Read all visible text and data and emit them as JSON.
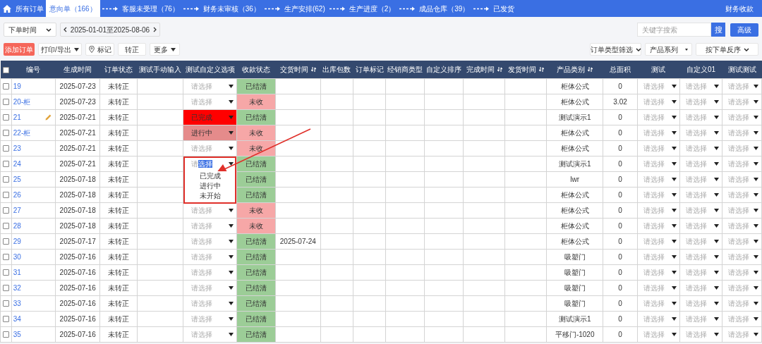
{
  "nav": {
    "tabs": [
      {
        "label": "所有订单",
        "selected": false,
        "kind": "home"
      },
      {
        "label": "意向单（166）",
        "selected": true,
        "kind": "plain"
      },
      {
        "label": "客服未受理（76）",
        "selected": false,
        "kind": "step"
      },
      {
        "label": "财务未审核（36）",
        "selected": false,
        "kind": "step"
      },
      {
        "label": "生产安排(62)",
        "selected": false,
        "kind": "step"
      },
      {
        "label": "生产进度（2）",
        "selected": false,
        "kind": "step"
      },
      {
        "label": "成品仓库（39）",
        "selected": false,
        "kind": "step"
      },
      {
        "label": "已发货",
        "selected": false,
        "kind": "step"
      }
    ],
    "right_link": "财务收款"
  },
  "filters": {
    "time_field": "下单时间",
    "date_range": "2025-01-01至2025-08-06",
    "search": {
      "placeholder": "关键字搜索"
    },
    "search_button": "搜",
    "advanced_button": "高级"
  },
  "actions": {
    "add": "添加订单",
    "print": "打印/导出",
    "mark": "标记",
    "convert": "转正",
    "more": "更多"
  },
  "sorters": {
    "order_type": "订单类型筛选",
    "series": "产品系列",
    "sort": "按下单反序"
  },
  "table": {
    "select_all": {
      "checked": false
    },
    "columns": [
      {
        "label": "编号",
        "sortable": false
      },
      {
        "label": "生成时间",
        "sortable": false
      },
      {
        "label": "订单状态",
        "sortable": false
      },
      {
        "label": "测试手动输入",
        "sortable": false
      },
      {
        "label": "测试自定义选项",
        "sortable": false
      },
      {
        "label": "收款状态",
        "sortable": false
      },
      {
        "label": "交货时间",
        "sortable": true
      },
      {
        "label": "出库包数",
        "sortable": false
      },
      {
        "label": "订单标记",
        "sortable": false
      },
      {
        "label": "经销商类型",
        "sortable": false
      },
      {
        "label": "自定义排序",
        "sortable": false
      },
      {
        "label": "完成时间",
        "sortable": true
      },
      {
        "label": "发货时间",
        "sortable": true
      },
      {
        "label": "产品类别",
        "sortable": true
      },
      {
        "label": "总面积",
        "sortable": false
      },
      {
        "label": "测试",
        "sortable": false
      },
      {
        "label": "自定义01",
        "sortable": false
      },
      {
        "label": "测试测试",
        "sortable": false
      }
    ],
    "rows": [
      {
        "checked": false,
        "id": "19",
        "pencil": false,
        "date": "2025-07-23",
        "status": "未转正",
        "option": {
          "text": "请选择",
          "kind": "empty"
        },
        "payment": {
          "text": "已结清",
          "kind": "paid"
        },
        "product": "柜体公式",
        "area": "0",
        "selects": [
          "请选择",
          "请选择",
          "请选择"
        ]
      },
      {
        "checked": false,
        "id": "20-柜",
        "pencil": false,
        "date": "2025-07-23",
        "status": "未转正",
        "option": {
          "text": "请选择",
          "kind": "empty"
        },
        "payment": {
          "text": "未收",
          "kind": "unpaid"
        },
        "product": "柜体公式",
        "area": "3.02",
        "selects": [
          "请选择",
          "请选择",
          "请选择"
        ]
      },
      {
        "checked": false,
        "id": "21",
        "pencil": true,
        "date": "2025-07-21",
        "status": "未转正",
        "option": {
          "text": "已完成",
          "kind": "done"
        },
        "payment": {
          "text": "已结清",
          "kind": "paid"
        },
        "product": "测试演示1",
        "area": "0",
        "selects": [
          "请选择",
          "请选择",
          "请选择"
        ]
      },
      {
        "checked": false,
        "id": "22-柜",
        "pencil": false,
        "date": "2025-07-21",
        "status": "未转正",
        "option": {
          "text": "进行中",
          "kind": "progress"
        },
        "payment": {
          "text": "未收",
          "kind": "unpaid"
        },
        "product": "柜体公式",
        "area": "0",
        "selects": [
          "请选择",
          "请选择",
          "请选择"
        ]
      },
      {
        "checked": false,
        "id": "23",
        "pencil": false,
        "date": "2025-07-21",
        "status": "未转正",
        "option": {
          "text": "请选择",
          "kind": "empty"
        },
        "payment": {
          "text": "未收",
          "kind": "unpaid"
        },
        "product": "柜体公式",
        "area": "0",
        "selects": [
          "请选择",
          "请选择",
          "请选择"
        ]
      },
      {
        "checked": false,
        "id": "24",
        "pencil": false,
        "date": "2025-07-21",
        "status": "未转正",
        "option": {
          "text": "请",
          "selected_text": "选择",
          "kind": "empty",
          "open": true,
          "annotated": true,
          "options": [
            "已完成",
            "进行中",
            "未开始"
          ]
        },
        "payment": {
          "text": "已结清",
          "kind": "paid"
        },
        "product": "测试演示1",
        "area": "0",
        "selects": [
          "请选择",
          "请选择",
          "请选择"
        ]
      },
      {
        "checked": false,
        "id": "25",
        "pencil": false,
        "date": "2025-07-18",
        "status": "未转正",
        "payment": {
          "text": "已结清",
          "kind": "paid"
        },
        "product": "lwr",
        "area": "0",
        "selects": [
          "请选择",
          "请选择",
          "请选择"
        ]
      },
      {
        "checked": false,
        "id": "26",
        "pencil": false,
        "date": "2025-07-18",
        "status": "未转正",
        "payment": {
          "text": "已结清",
          "kind": "paid"
        },
        "product": "柜体公式",
        "area": "0",
        "selects": [
          "请选择",
          "请选择",
          "请选择"
        ]
      },
      {
        "checked": false,
        "id": "27",
        "pencil": false,
        "date": "2025-07-18",
        "status": "未转正",
        "option": {
          "text": "请选择",
          "kind": "empty"
        },
        "payment": {
          "text": "未收",
          "kind": "unpaid"
        },
        "product": "柜体公式",
        "area": "0",
        "selects": [
          "请选择",
          "请选择",
          "请选择"
        ]
      },
      {
        "checked": false,
        "id": "28",
        "pencil": false,
        "date": "2025-07-18",
        "status": "未转正",
        "option": {
          "text": "请选择",
          "kind": "empty"
        },
        "payment": {
          "text": "未收",
          "kind": "unpaid"
        },
        "product": "柜体公式",
        "area": "0",
        "selects": [
          "请选择",
          "请选择",
          "请选择"
        ]
      },
      {
        "checked": false,
        "id": "29",
        "pencil": false,
        "date": "2025-07-17",
        "status": "未转正",
        "option": {
          "text": "请选择",
          "kind": "empty"
        },
        "payment": {
          "text": "已结清",
          "kind": "paid"
        },
        "delivery": "2025-07-24",
        "product": "柜体公式",
        "area": "0",
        "selects": [
          "请选择",
          "请选择",
          "请选择"
        ]
      },
      {
        "checked": false,
        "id": "30",
        "pencil": false,
        "date": "2025-07-16",
        "status": "未转正",
        "option": {
          "text": "请选择",
          "kind": "empty"
        },
        "payment": {
          "text": "已结清",
          "kind": "paid"
        },
        "product": "吸塑门",
        "area": "0",
        "selects": [
          "请选择",
          "请选择",
          "请选择"
        ]
      },
      {
        "checked": false,
        "id": "31",
        "pencil": false,
        "date": "2025-07-16",
        "status": "未转正",
        "option": {
          "text": "请选择",
          "kind": "empty"
        },
        "payment": {
          "text": "已结清",
          "kind": "paid"
        },
        "product": "吸塑门",
        "area": "0",
        "selects": [
          "请选择",
          "请选择",
          "请选择"
        ]
      },
      {
        "checked": false,
        "id": "32",
        "pencil": false,
        "date": "2025-07-16",
        "status": "未转正",
        "option": {
          "text": "请选择",
          "kind": "empty"
        },
        "payment": {
          "text": "已结清",
          "kind": "paid"
        },
        "product": "吸塑门",
        "area": "0",
        "selects": [
          "请选择",
          "请选择",
          "请选择"
        ]
      },
      {
        "checked": false,
        "id": "33",
        "pencil": false,
        "date": "2025-07-16",
        "status": "未转正",
        "option": {
          "text": "请选择",
          "kind": "empty"
        },
        "payment": {
          "text": "已结清",
          "kind": "paid"
        },
        "product": "吸塑门",
        "area": "0",
        "selects": [
          "请选择",
          "请选择",
          "请选择"
        ]
      },
      {
        "checked": false,
        "id": "34",
        "pencil": false,
        "date": "2025-07-16",
        "status": "未转正",
        "option": {
          "text": "请选择",
          "kind": "empty"
        },
        "payment": {
          "text": "已结清",
          "kind": "paid"
        },
        "product": "测试演示1",
        "area": "0",
        "selects": [
          "请选择",
          "请选择",
          "请选择"
        ]
      },
      {
        "checked": false,
        "id": "35",
        "pencil": false,
        "date": "2025-07-16",
        "status": "未转正",
        "option": {
          "text": "请选择",
          "kind": "empty"
        },
        "payment": {
          "text": "已结清",
          "kind": "paid"
        },
        "product": "平移门-1020",
        "area": "0",
        "selects": [
          "请选择",
          "请选择",
          "请选择"
        ]
      }
    ]
  },
  "annotation_arrow": true
}
